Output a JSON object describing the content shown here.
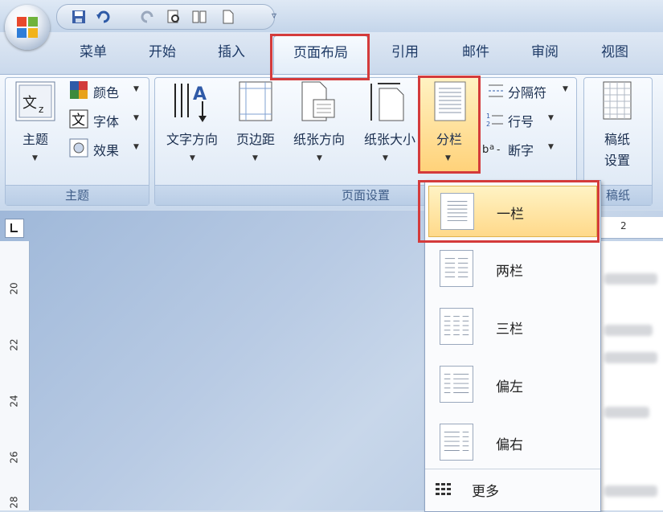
{
  "qat": {
    "icons": [
      "save-icon",
      "undo-icon",
      "redo-icon",
      "print-preview-icon",
      "columns-icon",
      "new-document-icon"
    ]
  },
  "tabs": [
    {
      "label": "菜单",
      "active": false
    },
    {
      "label": "开始",
      "active": false
    },
    {
      "label": "插入",
      "active": false
    },
    {
      "label": "页面布局",
      "active": true
    },
    {
      "label": "引用",
      "active": false
    },
    {
      "label": "邮件",
      "active": false
    },
    {
      "label": "审阅",
      "active": false
    },
    {
      "label": "视图",
      "active": false
    }
  ],
  "groups": {
    "theme": {
      "label": "主题",
      "main_button": "主题",
      "color": "颜色",
      "font": "字体",
      "effect": "效果"
    },
    "page_setup": {
      "label": "页面设置",
      "text_direction": "文字方向",
      "margins": "页边距",
      "orientation": "纸张方向",
      "size": "纸张大小",
      "columns": "分栏",
      "breaks": "分隔符",
      "line_numbers": "行号",
      "hyphenation": "断字"
    },
    "draft": {
      "label": "稿纸",
      "button_line1": "稿纸",
      "button_line2": "设置"
    }
  },
  "ruler": {
    "vertical_numbers": [
      "20",
      "22",
      "24",
      "26",
      "28"
    ],
    "horizontal_number": "2"
  },
  "columns_menu": {
    "items": [
      {
        "label": "一栏",
        "selected": true
      },
      {
        "label": "两栏",
        "selected": false
      },
      {
        "label": "三栏",
        "selected": false
      },
      {
        "label": "偏左",
        "selected": false
      },
      {
        "label": "偏右",
        "selected": false
      }
    ],
    "more": "更多"
  },
  "colors": {
    "highlight": "#d43b3b",
    "selected_bg": "#ffd98a",
    "tab_text": "#1e3a66"
  }
}
